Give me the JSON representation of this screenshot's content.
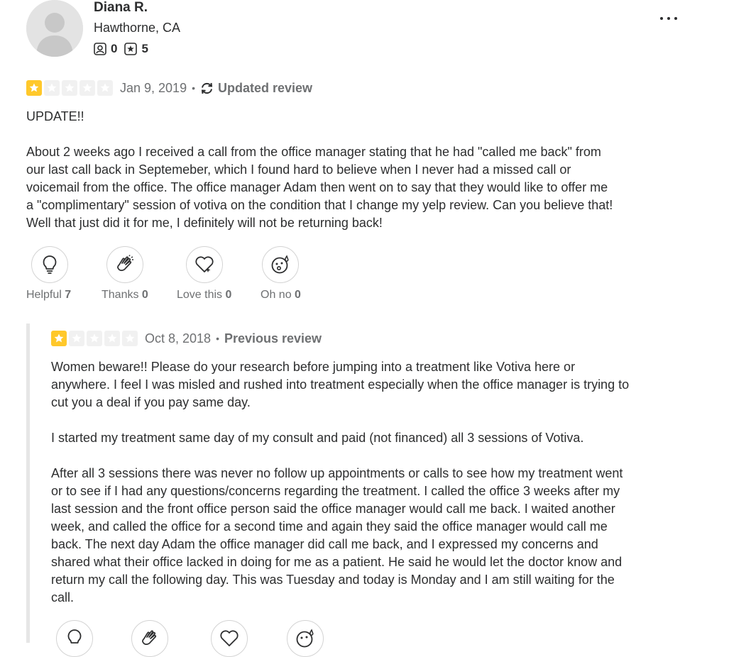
{
  "user": {
    "name": "Diana R.",
    "location": "Hawthorne, CA",
    "friends_count": "0",
    "reviews_count": "5"
  },
  "menu_icon": "more-horizontal-icon",
  "current_review": {
    "rating": 1,
    "date": "Jan 9, 2019",
    "separator": "•",
    "tag": "Updated review",
    "paragraphs": [
      "UPDATE!!",
      "About 2 weeks ago I received a call from the office manager stating that he had \"called me back\" from our last call back in Septemeber, which I found hard to believe when I never had a missed call or voicemail from the office. The office manager Adam then went on to say that they would like to offer me a \"complimentary\" session of votiva on the condition that I change my yelp review. Can you believe that! Well that just did it for me, I definitely will not be returning back!"
    ],
    "reactions": [
      {
        "label": "Helpful",
        "count": "7",
        "icon": "lightbulb-icon"
      },
      {
        "label": "Thanks",
        "count": "0",
        "icon": "clapping-hands-icon"
      },
      {
        "label": "Love this",
        "count": "0",
        "icon": "heart-icon"
      },
      {
        "label": "Oh no",
        "count": "0",
        "icon": "surprised-face-icon"
      }
    ]
  },
  "previous_review": {
    "rating": 1,
    "date": "Oct 8, 2018",
    "separator": "•",
    "tag": "Previous review",
    "paragraphs": [
      "Women beware!! Please do your research before jumping into a treatment like Votiva here or anywhere. I feel I was misled and rushed into treatment especially when the office manager is trying to cut you a deal if you pay same day.",
      "I started my treatment same day of my consult and paid (not financed) all 3 sessions of Votiva.",
      "After all 3 sessions there was never no follow up appointments or calls to see how my treatment went or to see if I had any questions/concerns regarding the treatment. I called the office 3 weeks after my last session and the front office person said the office manager would call me back. I waited another week, and called the office for a second time and again they said the office manager would call me back. The next day Adam the office manager did call me back, and I expressed my concerns and shared what their office lacked in doing for me as a patient. He said he would let the doctor know and return my call the following day. This was Tuesday and today is Monday and I am still waiting for the call."
    ]
  },
  "colors": {
    "star_on": "#ffc82b",
    "star_off": "#f1f1f1",
    "text": "#2d2e2f",
    "muted": "#6e7072"
  }
}
